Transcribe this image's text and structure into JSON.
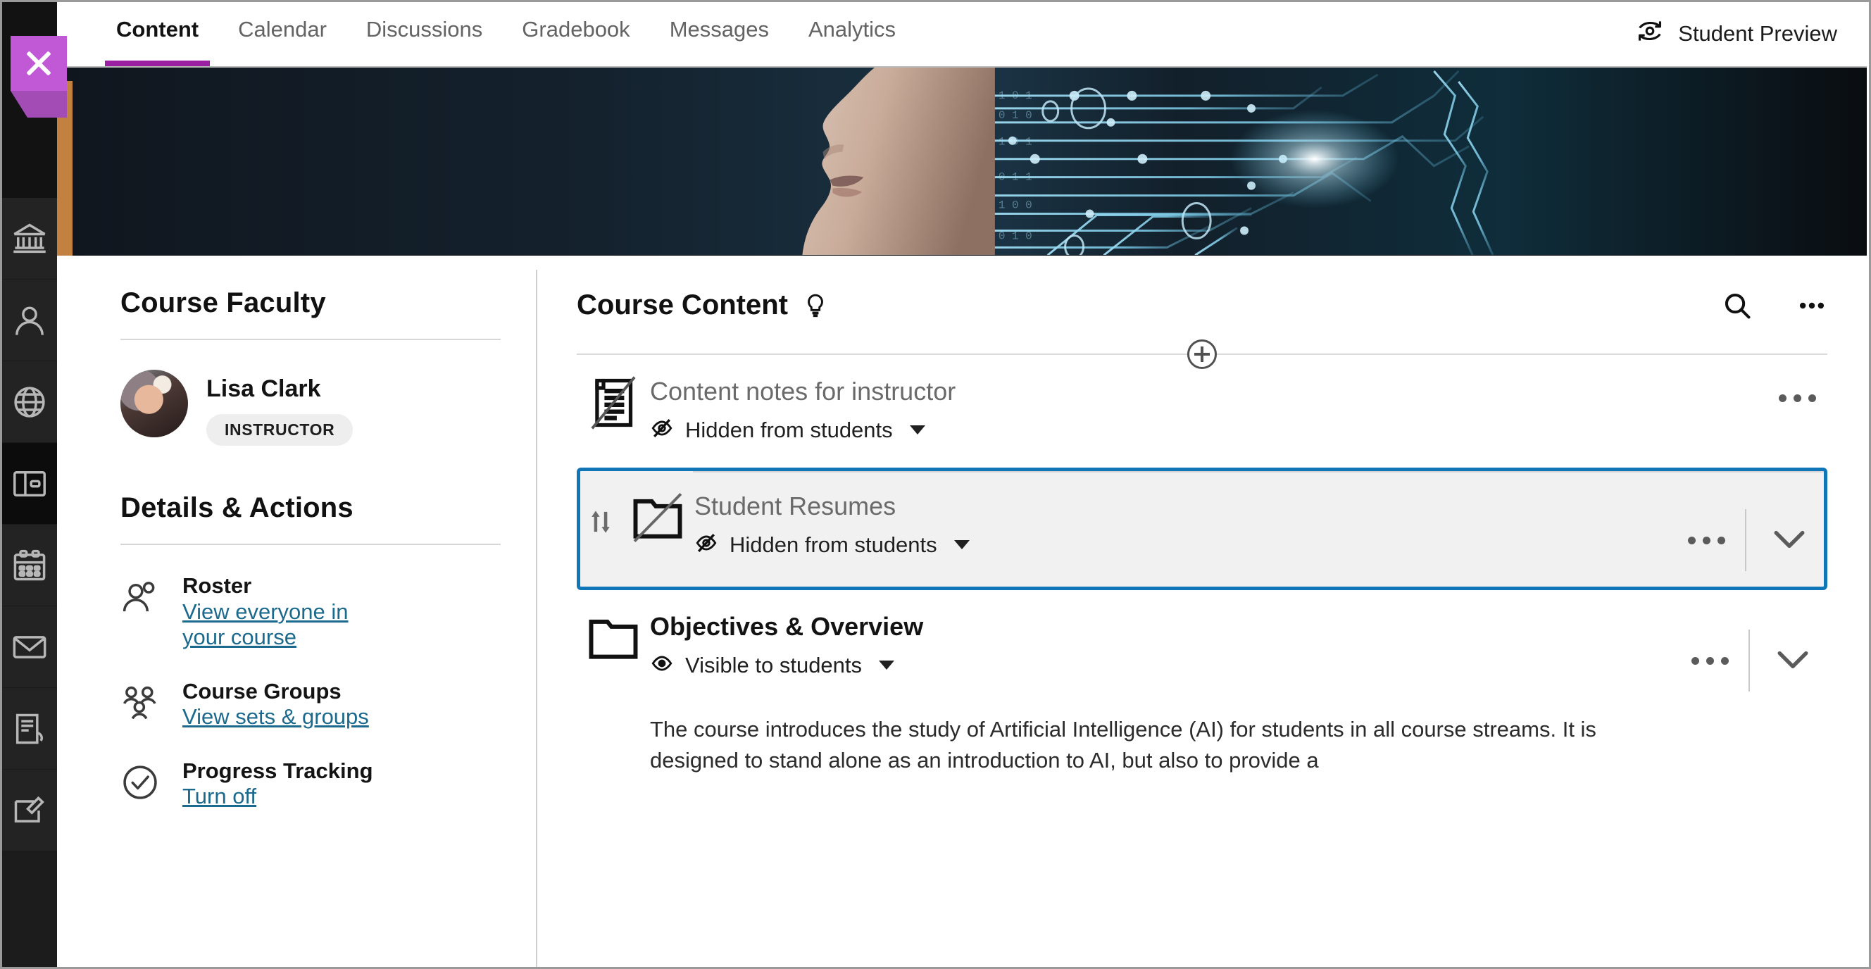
{
  "nav": {
    "tabs": [
      {
        "label": "Content",
        "active": true
      },
      {
        "label": "Calendar",
        "active": false
      },
      {
        "label": "Discussions",
        "active": false
      },
      {
        "label": "Gradebook",
        "active": false
      },
      {
        "label": "Messages",
        "active": false
      },
      {
        "label": "Analytics",
        "active": false
      }
    ],
    "student_preview_label": "Student Preview",
    "student_preview_icon": "student-preview-icon",
    "active_underline_color": "#9b1fa1"
  },
  "rail": {
    "close_icon": "close-icon",
    "close_tab_color": "#c159d6",
    "items": [
      {
        "icon": "institution-icon",
        "name": "institution"
      },
      {
        "icon": "profile-icon",
        "name": "profile"
      },
      {
        "icon": "globe-icon",
        "name": "globe"
      },
      {
        "icon": "courses-icon",
        "name": "courses"
      },
      {
        "icon": "calendar-icon",
        "name": "calendar"
      },
      {
        "icon": "messages-icon",
        "name": "messages"
      },
      {
        "icon": "grades-icon",
        "name": "grades"
      },
      {
        "icon": "tools-icon",
        "name": "tools"
      }
    ]
  },
  "banner": {
    "alt": "course-banner-image",
    "description": "Profile of a face with glowing cyan circuit board traces on a dark background"
  },
  "faculty": {
    "heading": "Course Faculty",
    "members": [
      {
        "name": "Lisa Clark",
        "role": "INSTRUCTOR",
        "avatar": "instructor-avatar"
      }
    ]
  },
  "details": {
    "heading": "Details & Actions",
    "actions": [
      {
        "icon": "roster-icon",
        "title": "Roster",
        "link": "View everyone in your course"
      },
      {
        "icon": "groups-icon",
        "title": "Course Groups",
        "link": "View sets & groups"
      },
      {
        "icon": "progress-icon",
        "title": "Progress Tracking",
        "link": "Turn off"
      }
    ]
  },
  "content": {
    "heading": "Course Content",
    "heading_icon": "lightbulb-icon",
    "search_icon": "search-icon",
    "more_icon": "more-options-icon",
    "add_icon": "add-content-icon",
    "selected_border_color": "#1176b8",
    "items": [
      {
        "title": "Content notes for instructor",
        "icon": "document-hidden-icon",
        "visibility": "Hidden from students",
        "visibility_icon": "eye-hidden-icon",
        "selected": false,
        "has_chevron": false,
        "has_drag_handle": false,
        "description": ""
      },
      {
        "title": "Student Resumes",
        "icon": "folder-hidden-icon",
        "visibility": "Hidden from students",
        "visibility_icon": "eye-hidden-icon",
        "selected": true,
        "has_chevron": true,
        "has_drag_handle": true,
        "drag_icon": "reorder-icon",
        "description": ""
      },
      {
        "title": "Objectives & Overview",
        "icon": "folder-icon",
        "visibility": "Visible to students",
        "visibility_icon": "eye-visible-icon",
        "selected": false,
        "has_chevron": true,
        "has_drag_handle": false,
        "description": "The course introduces the study of Artificial Intelligence (AI) for students in all course streams. It is designed to stand alone as an introduction to AI, but also to provide a"
      }
    ]
  }
}
